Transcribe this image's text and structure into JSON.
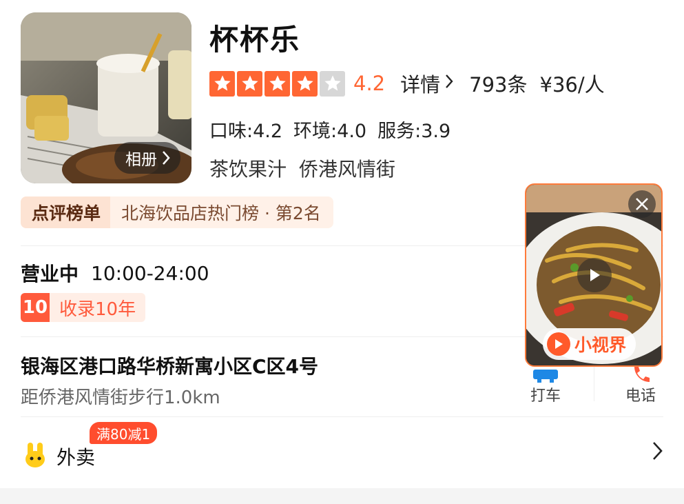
{
  "shop": {
    "name": "杯杯乐",
    "album_label": "相册",
    "rating": 4.2,
    "rating_text": "4.2",
    "stars_filled": 4,
    "stars_total": 5,
    "detail_label": "详情",
    "review_count": "793条",
    "price": "¥36/人",
    "subscores": {
      "taste": "口味:4.2",
      "environment": "环境:4.0",
      "service": "服务:3.9"
    },
    "category": "茶饮果汁",
    "area": "侨港风情街"
  },
  "ranking": {
    "label": "点评榜单",
    "text": "北海饮品店热门榜 · 第2名"
  },
  "hours": {
    "status": "营业中",
    "time": "10:00-24:00"
  },
  "recorded": {
    "years_number": "10",
    "text": "收录10年"
  },
  "address": {
    "line": "银海区港口路华桥新寓小区C区4号",
    "distance": "距侨港风情街步行1.0km"
  },
  "actions": {
    "taxi": "打车",
    "phone": "电话"
  },
  "takeout": {
    "label": "外卖",
    "promo": "满80减1"
  },
  "video": {
    "brand": "小视界"
  },
  "colors": {
    "accent": "#ff6633",
    "promo_red": "#ff4d2e",
    "rank_bg": "#fff1e8"
  },
  "icons": [
    "chevron-right-icon",
    "star-icon",
    "close-icon",
    "play-icon",
    "taxi-icon",
    "phone-icon",
    "takeout-icon"
  ]
}
